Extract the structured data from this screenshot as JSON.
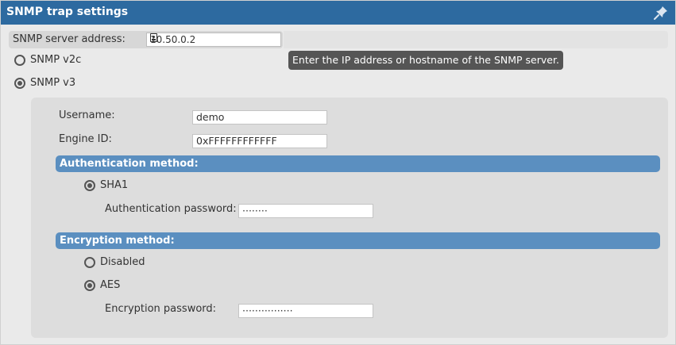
{
  "window": {
    "title": "SNMP trap settings",
    "pin_icon": "pin-icon"
  },
  "server": {
    "label": "SNMP server address:",
    "value": "10.50.0.2",
    "icon": "contact-card-icon",
    "tooltip": "Enter the IP address or hostname of the SNMP server."
  },
  "version_options": [
    {
      "label": "SNMP v2c",
      "checked": false
    },
    {
      "label": "SNMP v3",
      "checked": true
    }
  ],
  "v3": {
    "username_label": "Username:",
    "username_value": "demo",
    "engine_label": "Engine ID:",
    "engine_value": "0xFFFFFFFFFFFF",
    "auth": {
      "heading": "Authentication method:",
      "options": [
        {
          "label": "SHA1",
          "checked": true
        }
      ],
      "password_label": "Authentication password:",
      "password_value": "········"
    },
    "encryption": {
      "heading": "Encryption method:",
      "options": [
        {
          "label": "Disabled",
          "checked": false
        },
        {
          "label": "AES",
          "checked": true
        }
      ],
      "password_label": "Encryption password:",
      "password_value": "················"
    }
  }
}
